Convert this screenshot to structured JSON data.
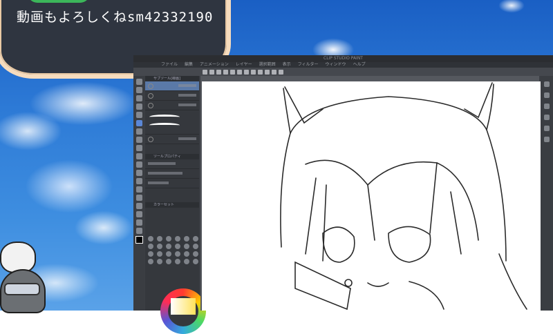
{
  "overlay": {
    "bubble_text": "動画もよろしくねsm42332190"
  },
  "app": {
    "title": "CLIP STUDIO PAINT",
    "menu": [
      "ファイル",
      "編集",
      "アニメーション",
      "レイヤー",
      "選択範囲",
      "表示",
      "フィルター",
      "ウィンドウ",
      "ヘルプ"
    ],
    "sub_tool_header": "サブツール[線画]",
    "tool_property_header": "ツールプロパティ",
    "color_set_header": "カラーセット"
  },
  "colors": {
    "sky": "#2d7ad6",
    "bubble_bg": "#2f3540",
    "bubble_border": "#f6dcbe",
    "app_bg": "#3b3e44",
    "selection": "#5a79a8"
  }
}
